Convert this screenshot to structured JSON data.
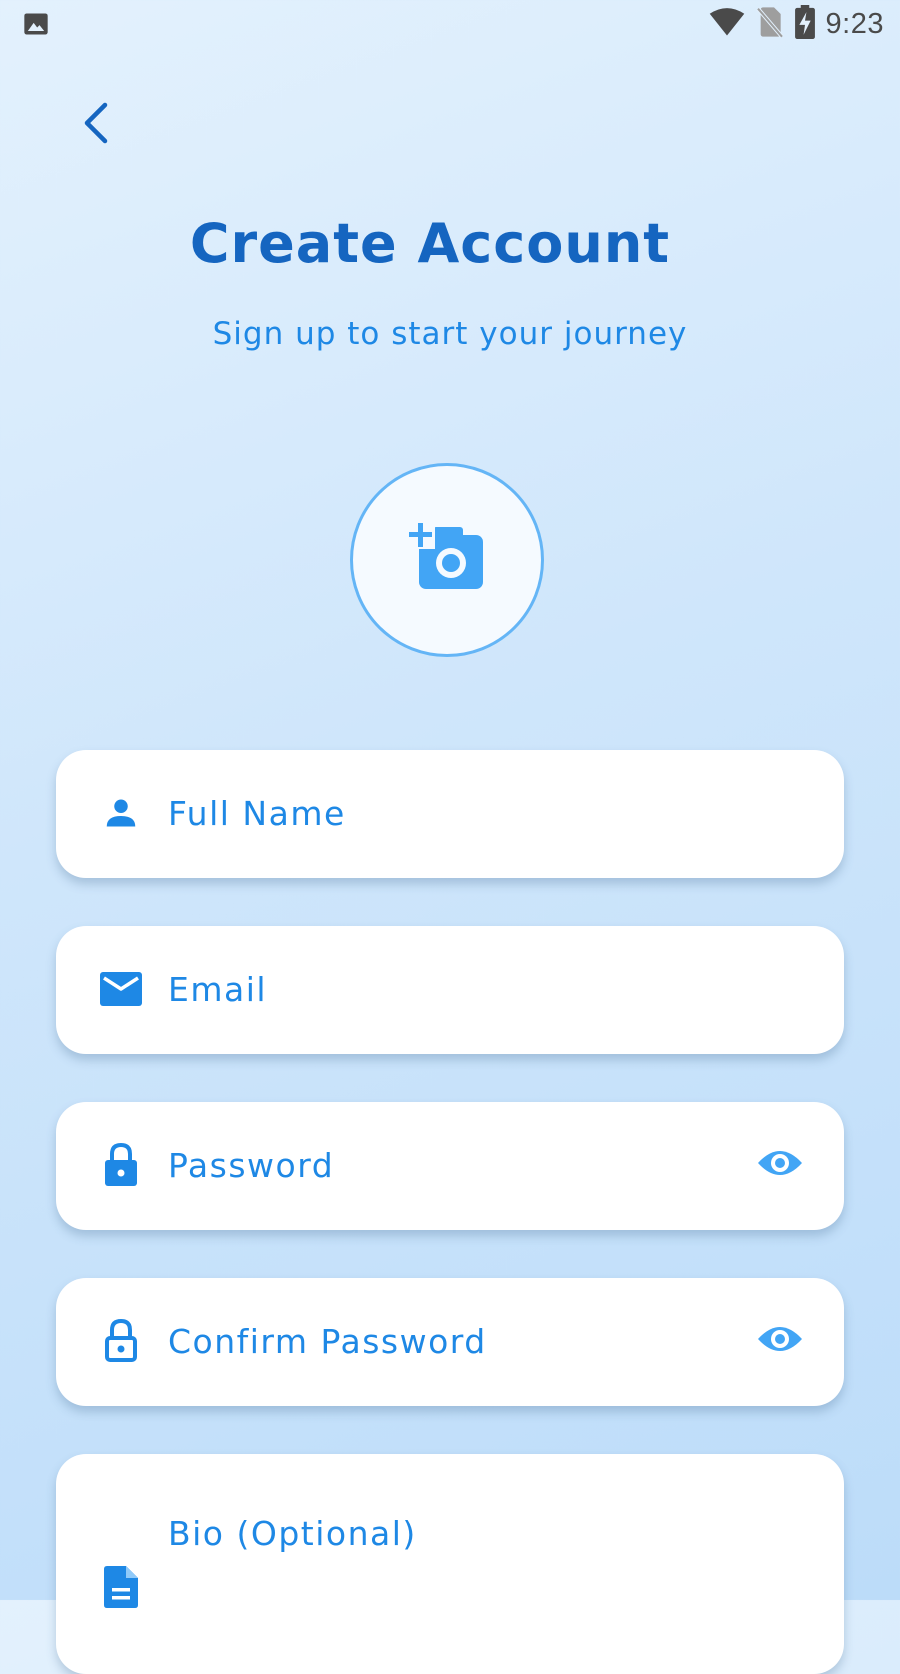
{
  "status_bar": {
    "time": "9:23"
  },
  "header": {
    "title": "Create Account",
    "subtitle": "Sign up to start your journey"
  },
  "form": {
    "full_name": {
      "placeholder": "Full Name",
      "icon": "person-icon"
    },
    "email": {
      "placeholder": "Email",
      "icon": "mail-icon"
    },
    "password": {
      "placeholder": "Password",
      "icon": "lock-icon",
      "toggle_icon": "eye-icon"
    },
    "confirm_password": {
      "placeholder": "Confirm Password",
      "icon": "lock-outline-icon",
      "toggle_icon": "eye-icon"
    },
    "bio": {
      "placeholder": "Bio (Optional)",
      "icon": "document-icon"
    }
  },
  "colors": {
    "primary": "#1e88e5",
    "title": "#1565c0",
    "accent_light": "#64b5f6",
    "icon_light": "#42a5f5"
  }
}
